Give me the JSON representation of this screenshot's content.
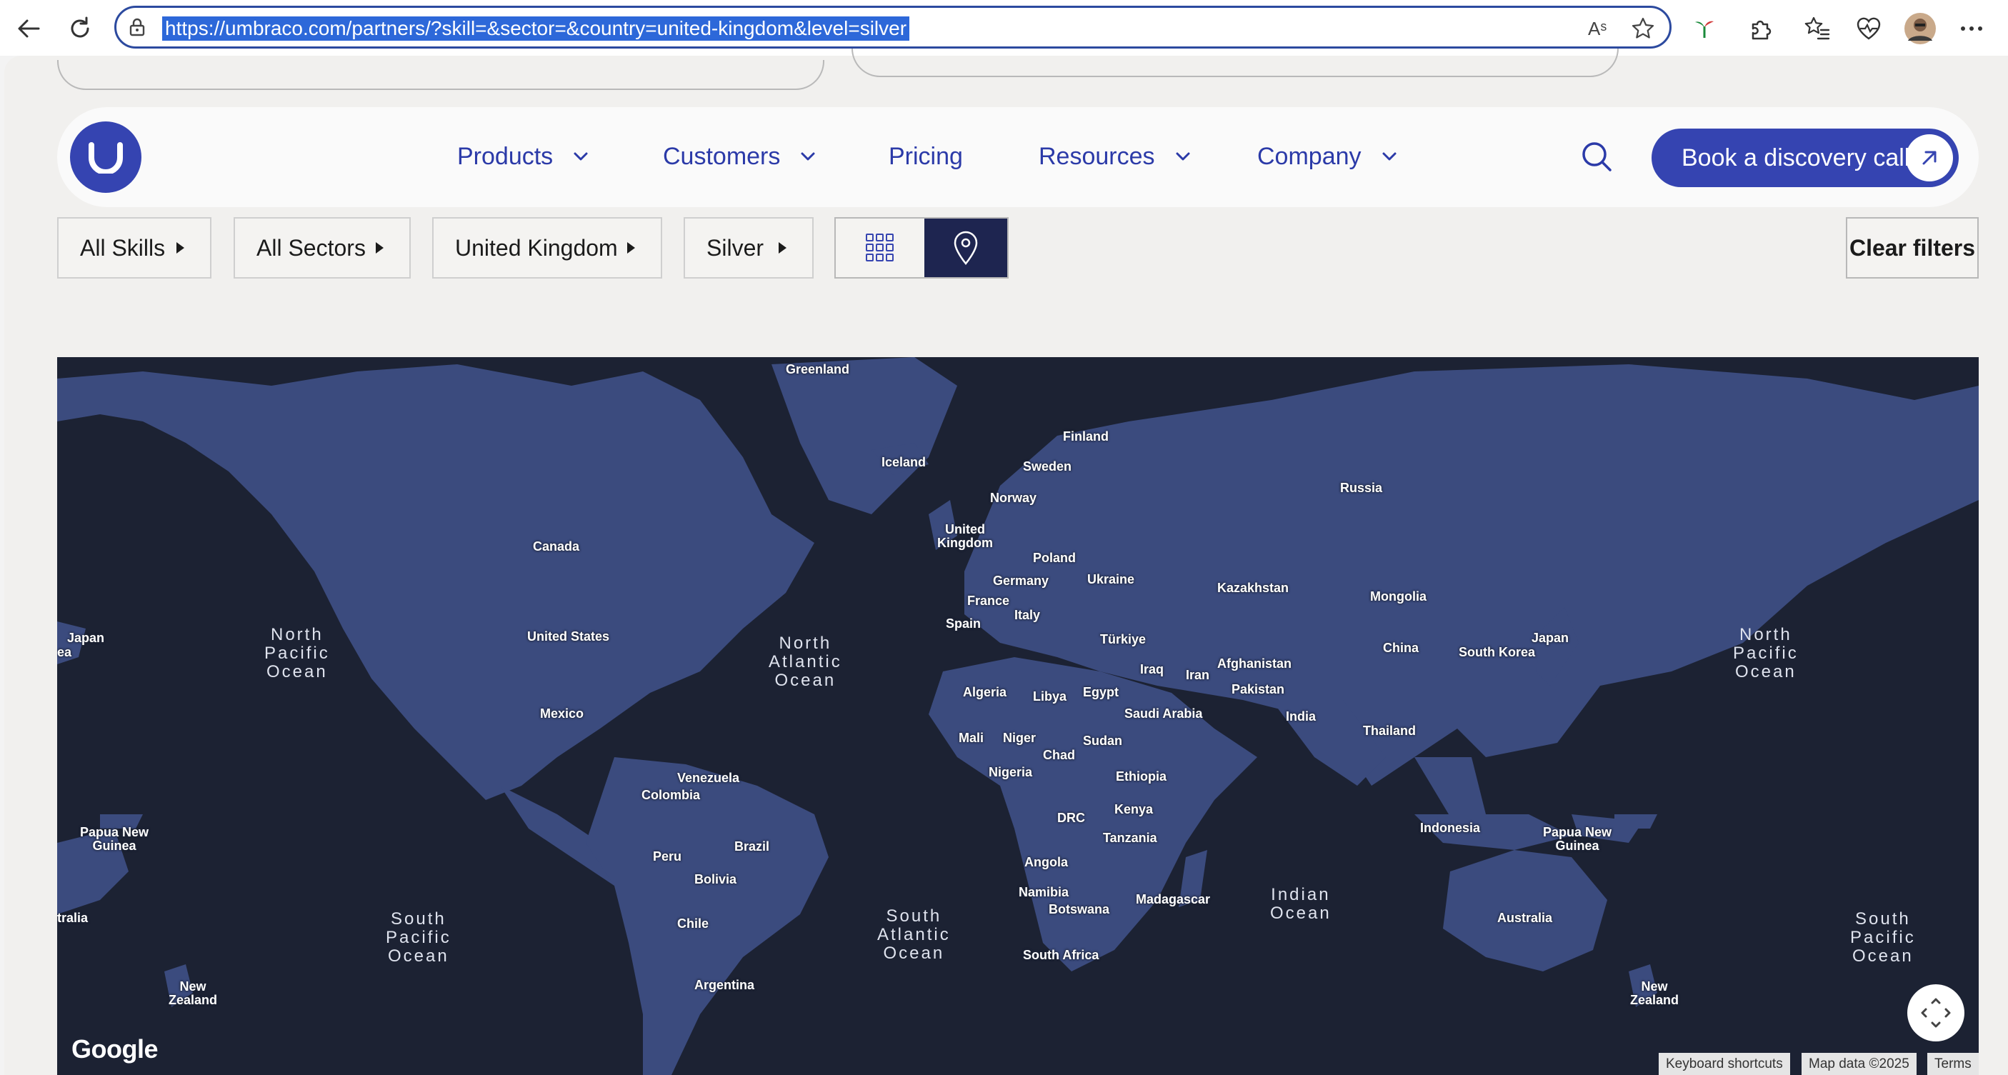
{
  "browser": {
    "url": "https://umbraco.com/partners/?skill=&sector=&country=united-kingdom&level=silver",
    "icons": [
      "back-icon",
      "refresh-icon",
      "lock-icon",
      "read-aloud-icon",
      "favorite-star-icon",
      "extension-icon",
      "puzzle-icon",
      "favorites-icon",
      "health-icon",
      "profile-avatar",
      "more-icon"
    ],
    "read_aloud_text": "Aˢ"
  },
  "header": {
    "nav": {
      "products": "Products",
      "customers": "Customers",
      "pricing": "Pricing",
      "resources": "Resources",
      "company": "Company"
    },
    "cta_label": "Book a discovery call",
    "colors": {
      "brand": "#3544b1",
      "nav_text": "#2b3aa8"
    }
  },
  "filters": {
    "skills": "All Skills",
    "sectors": "All Sectors",
    "country": "United Kingdom",
    "level": "Silver",
    "clear": "Clear filters",
    "active_view": "map"
  },
  "map": {
    "countries": [
      {
        "name": "Greenland"
      },
      {
        "name": "Finland"
      },
      {
        "name": "Iceland"
      },
      {
        "name": "Sweden"
      },
      {
        "name": "Russia"
      },
      {
        "name": "Norway"
      },
      {
        "name": "United\nKingdom"
      },
      {
        "name": "Canada"
      },
      {
        "name": "Poland"
      },
      {
        "name": "Ukraine"
      },
      {
        "name": "Germany"
      },
      {
        "name": "Kazakhstan"
      },
      {
        "name": "France"
      },
      {
        "name": "Mongolia"
      },
      {
        "name": "Italy"
      },
      {
        "name": "Spain"
      },
      {
        "name": "Japan"
      },
      {
        "name": "United States"
      },
      {
        "name": "Türkiye"
      },
      {
        "name": "China"
      },
      {
        "name": "South Korea"
      },
      {
        "name": "Japan"
      },
      {
        "name": "ea"
      },
      {
        "name": "Iraq"
      },
      {
        "name": "Afghanistan"
      },
      {
        "name": "Iran"
      },
      {
        "name": "Algeria"
      },
      {
        "name": "Libya"
      },
      {
        "name": "Egypt"
      },
      {
        "name": "Pakistan"
      },
      {
        "name": "Mexico"
      },
      {
        "name": "Saudi Arabia"
      },
      {
        "name": "India"
      },
      {
        "name": "Thailand"
      },
      {
        "name": "Mali"
      },
      {
        "name": "Niger"
      },
      {
        "name": "Sudan"
      },
      {
        "name": "Chad"
      },
      {
        "name": "Nigeria"
      },
      {
        "name": "Ethiopia"
      },
      {
        "name": "Venezuela"
      },
      {
        "name": "Colombia"
      },
      {
        "name": "Kenya"
      },
      {
        "name": "DRC"
      },
      {
        "name": "Papua New\nGuinea"
      },
      {
        "name": "Indonesia"
      },
      {
        "name": "Papua New\nGuinea"
      },
      {
        "name": "Tanzania"
      },
      {
        "name": "Brazil"
      },
      {
        "name": "Peru"
      },
      {
        "name": "Angola"
      },
      {
        "name": "Bolivia"
      },
      {
        "name": "Namibia"
      },
      {
        "name": "Madagascar"
      },
      {
        "name": "Botswana"
      },
      {
        "name": "tralia"
      },
      {
        "name": "Australia"
      },
      {
        "name": "Chile"
      },
      {
        "name": "South Africa"
      },
      {
        "name": "Argentina"
      },
      {
        "name": "New\nZealand"
      },
      {
        "name": "New\nZealand"
      }
    ],
    "oceans": [
      {
        "name": "North\nPacific\nOcean"
      },
      {
        "name": "North\nAtlantic\nOcean"
      },
      {
        "name": "North\nPacific\nOcean"
      },
      {
        "name": "Indian\nOcean"
      },
      {
        "name": "South\nPacific\nOcean"
      },
      {
        "name": "South\nAtlantic\nOcean"
      },
      {
        "name": "South\nPacific\nOcean"
      }
    ],
    "google_logo": "Google",
    "attribution": {
      "shortcuts": "Keyboard shortcuts",
      "data": "Map data ©2025",
      "terms": "Terms"
    },
    "colors": {
      "ocean": "#1c2233",
      "land": "#3b4b7e"
    }
  }
}
